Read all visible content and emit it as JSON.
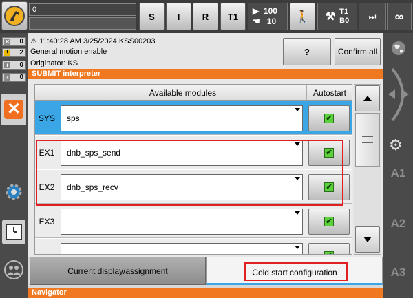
{
  "topbar": {
    "progress_value": "0",
    "btn_s": "S",
    "btn_i": "I",
    "btn_r": "R",
    "btn_t1": "T1",
    "override_prog": "100",
    "override_jog": "10",
    "mode_t1": "T1",
    "mode_b0": "B0",
    "infinity": "∞"
  },
  "status_counts": [
    {
      "icon": "x",
      "count": "0",
      "color": "#888888"
    },
    {
      "icon": "!",
      "count": "2",
      "color": "#e8b800"
    },
    {
      "icon": "i",
      "count": "0",
      "color": "#888888"
    },
    {
      "icon": "<",
      "count": "0",
      "color": "#888888"
    }
  ],
  "message": {
    "header": "11:40:28 AM 3/25/2024 KSS00203",
    "text": "General motion enable",
    "originator": "Originator: KS",
    "help_label": "?",
    "confirm_all_label": "Confirm all"
  },
  "title": "SUBMIT interpreter",
  "table": {
    "col_available": "Available modules",
    "col_autostart": "Autostart",
    "rows": [
      {
        "label": "SYS",
        "value": "sps",
        "checked": "✔"
      },
      {
        "label": "EX1",
        "value": "dnb_sps_send",
        "checked": "✔"
      },
      {
        "label": "EX2",
        "value": "dnb_sps_recv",
        "checked": "✔"
      },
      {
        "label": "EX3",
        "value": "",
        "checked": "✔"
      },
      {
        "label": "",
        "value": "",
        "checked": "✔"
      }
    ]
  },
  "tabs": {
    "current": "Current display/assignment",
    "cold": "Cold start configuration"
  },
  "navigator": "Navigator",
  "rightbar": {
    "a1": "A1",
    "a2": "A2",
    "a3": "A3"
  },
  "colors": {
    "accent_orange": "#f07820",
    "selection_blue": "#3aa6e6",
    "highlight_red": "#e02020",
    "check_green": "#5ad13a"
  }
}
